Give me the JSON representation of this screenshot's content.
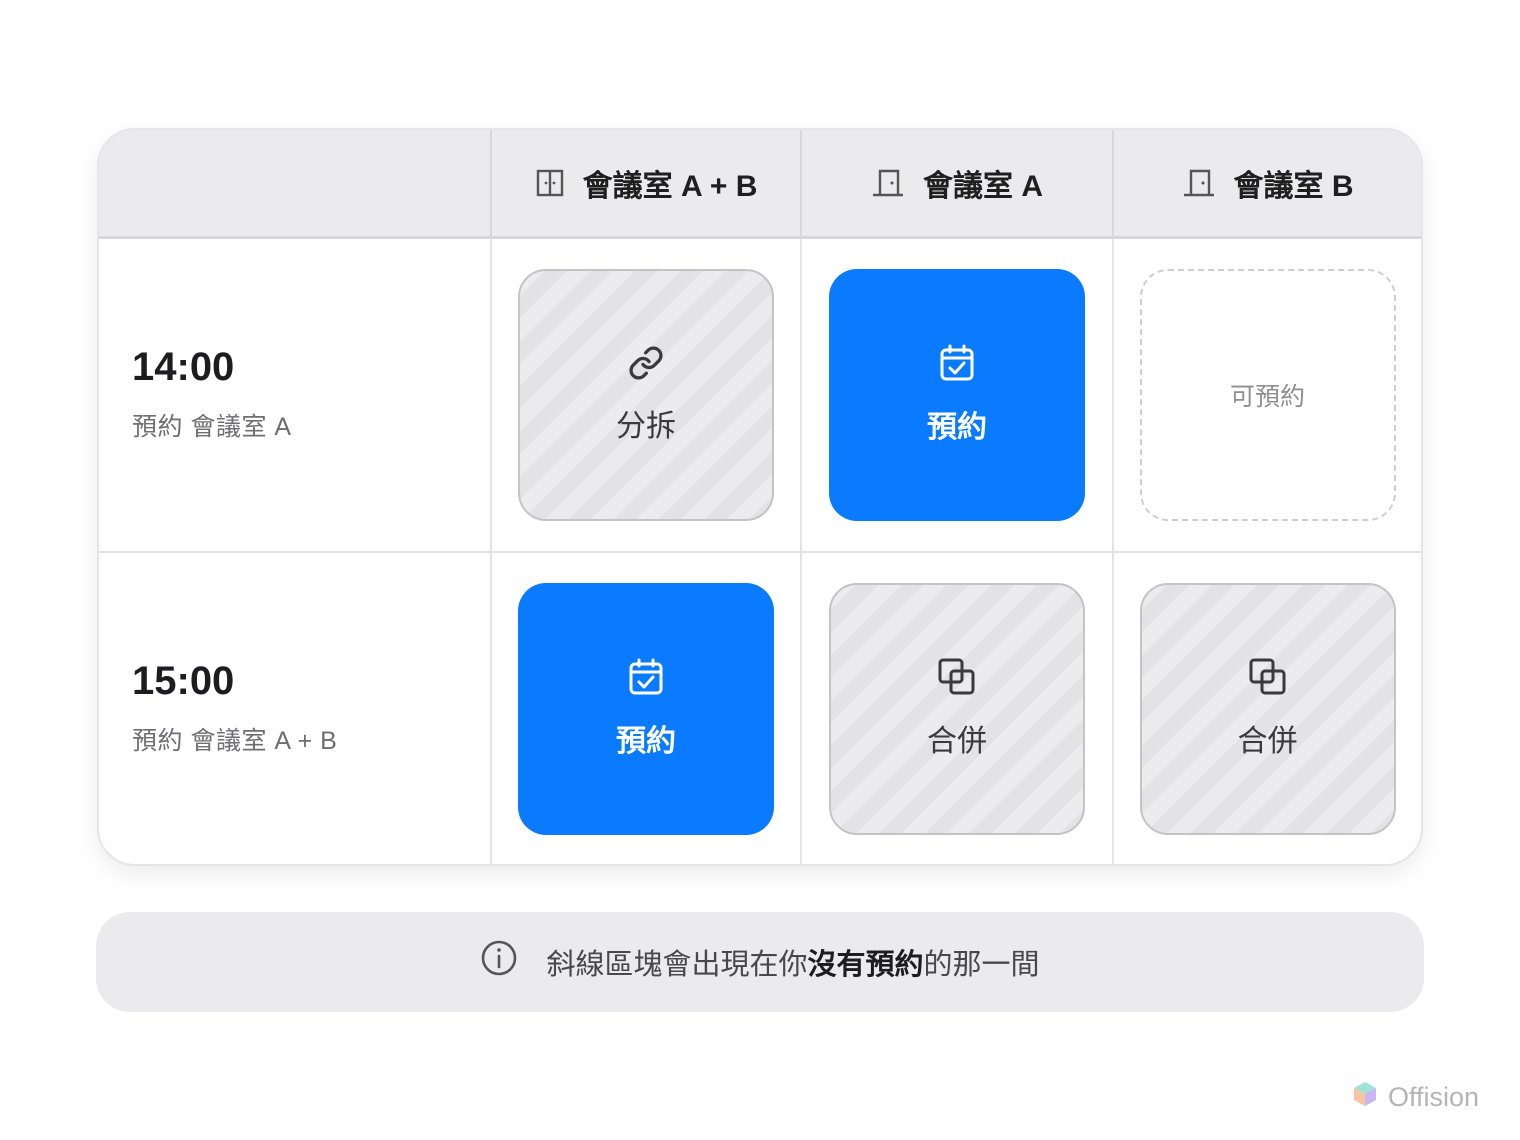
{
  "header": {
    "columns": [
      {
        "label": "",
        "icon": "none"
      },
      {
        "label": "會議室 A + B",
        "icon": "double-door-icon"
      },
      {
        "label": "會議室 A",
        "icon": "door-icon"
      },
      {
        "label": "會議室 B",
        "icon": "door-icon"
      }
    ]
  },
  "rows": [
    {
      "time": "14:00",
      "subtitle": "預約 會議室 A",
      "cells": [
        {
          "state": "hatched",
          "label": "分拆",
          "icon": "link-icon"
        },
        {
          "state": "booked",
          "label": "預約",
          "icon": "calendar-check-icon"
        },
        {
          "state": "available",
          "label": "可預約",
          "icon": "none"
        }
      ]
    },
    {
      "time": "15:00",
      "subtitle": "預約 會議室 A + B",
      "cells": [
        {
          "state": "booked",
          "label": "預約",
          "icon": "calendar-check-icon"
        },
        {
          "state": "hatched",
          "label": "合併",
          "icon": "merge-squares-icon"
        },
        {
          "state": "hatched",
          "label": "合併",
          "icon": "merge-squares-icon"
        }
      ]
    }
  ],
  "info": {
    "icon": "info-circle-icon",
    "text_before": "斜線區塊會出現在你",
    "text_emphasis": "沒有預約",
    "text_after": "的那一間"
  },
  "brand": {
    "name": "Offision",
    "icon": "offision-logo-icon"
  },
  "colors": {
    "booked": "#0a7aff",
    "header_bg": "#ebebed",
    "hatch_light": "#ececee",
    "hatch_dark": "#e3e3e5"
  }
}
